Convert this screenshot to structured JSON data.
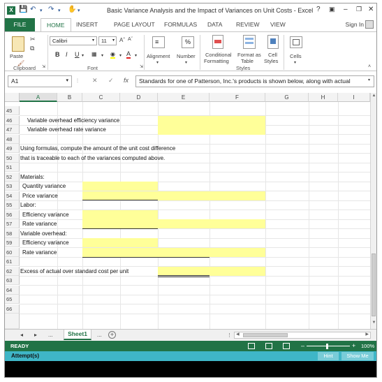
{
  "window": {
    "app_icon": "X",
    "title": "Basic Variance Analysis and the Impact of Variances on Unit Costs - Excel",
    "help": "?",
    "minimize": "–",
    "close": "✕"
  },
  "tabs": {
    "file": "FILE",
    "home": "HOME",
    "insert": "INSERT",
    "page_layout": "PAGE LAYOUT",
    "formulas": "FORMULAS",
    "data": "DATA",
    "review": "REVIEW",
    "view": "VIEW",
    "sign_in": "Sign In"
  },
  "ribbon": {
    "paste": "Paste",
    "font_name": "Calibri",
    "font_size": "11",
    "bold": "B",
    "italic": "I",
    "underline": "U",
    "alignment": "Alignment",
    "number": "Number",
    "percent": "%",
    "conditional_formatting": [
      "Conditional",
      "Formatting"
    ],
    "format_as_table": [
      "Format as",
      "Table"
    ],
    "cell_styles": [
      "Cell",
      "Styles"
    ],
    "cells": "Cells",
    "groups": {
      "clipboard": "Clipboard",
      "font": "Font",
      "styles": "Styles"
    }
  },
  "formula_bar": {
    "name_box": "A1",
    "fx": "fx",
    "content": "Standards for one of Patterson, Inc.'s products is shown below, along with actual"
  },
  "columns": [
    "A",
    "B",
    "C",
    "D",
    "E",
    "F",
    "G",
    "H",
    "I"
  ],
  "rows": [
    {
      "num": "45",
      "text": ""
    },
    {
      "num": "46",
      "text": "Variable overhead efficiency variance"
    },
    {
      "num": "47",
      "text": "Variable overhead rate variance"
    },
    {
      "num": "48",
      "text": ""
    },
    {
      "num": "49",
      "text": "Using formulas, compute the amount of the unit cost difference"
    },
    {
      "num": "50",
      "text": "that is traceable to each of the variances computed above."
    },
    {
      "num": "51",
      "text": ""
    },
    {
      "num": "52",
      "text": "Materials:"
    },
    {
      "num": "53",
      "text": "Quantity variance"
    },
    {
      "num": "54",
      "text": "Price variance"
    },
    {
      "num": "55",
      "text": "Labor:"
    },
    {
      "num": "56",
      "text": "Efficiency variance"
    },
    {
      "num": "57",
      "text": "Rate variance"
    },
    {
      "num": "58",
      "text": "Variable overhead:"
    },
    {
      "num": "59",
      "text": "Efficiency variance"
    },
    {
      "num": "60",
      "text": "Rate variance"
    },
    {
      "num": "61",
      "text": ""
    },
    {
      "num": "62",
      "text": "Excess of actual over standard cost per unit"
    },
    {
      "num": "63",
      "text": ""
    },
    {
      "num": "64",
      "text": ""
    },
    {
      "num": "65",
      "text": ""
    },
    {
      "num": "66",
      "text": ""
    }
  ],
  "sheets": {
    "ellipsis": "...",
    "active": "Sheet1",
    "ellipsis_after": "...",
    "add": "+"
  },
  "status": {
    "ready": "READY",
    "zoom": "100%"
  },
  "attempt_bar": {
    "label": "Attempt(s)",
    "hint": "Hint",
    "show_me": "Show Me"
  },
  "colors": {
    "excel_green": "#217346",
    "input_yellow": "#ffff99",
    "attempt_teal": "#3fb6c7"
  }
}
